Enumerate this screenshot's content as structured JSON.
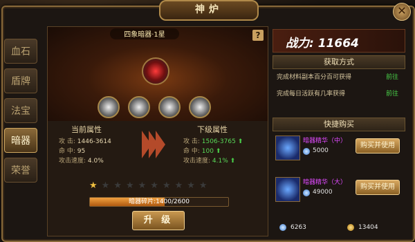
{
  "window": {
    "title": "神炉",
    "close_label": "✕"
  },
  "side_tabs": [
    {
      "label": "血石",
      "active": false
    },
    {
      "label": "盾牌",
      "active": false
    },
    {
      "label": "法宝",
      "active": false
    },
    {
      "label": "暗器",
      "active": true
    },
    {
      "label": "荣誉",
      "active": false
    }
  ],
  "item": {
    "name": "四象暗器·1星",
    "help": "?"
  },
  "current": {
    "heading": "当前属性",
    "attack_key": "攻    击:",
    "attack_val": "1446-3614",
    "hit_key": "命    中:",
    "hit_val": "95",
    "speed_key": "攻击速度:",
    "speed_val": "4.0%"
  },
  "next": {
    "heading": "下级属性",
    "attack_key": "攻    击:",
    "attack_val": "1506-3765",
    "hit_key": "命    中:",
    "hit_val": "100",
    "speed_key": "攻击速度:",
    "speed_val": "4.1%"
  },
  "stars": {
    "filled": 1,
    "total": 10
  },
  "progress": {
    "label": "暗器碎片:1400/2600",
    "current": 1400,
    "max": 2600
  },
  "upgrade_label": "升 级",
  "power": {
    "label": "战力: 11664"
  },
  "sources": {
    "heading": "获取方式",
    "rows": [
      {
        "text": "完成材料副本百分百可获得",
        "link": "前往"
      },
      {
        "text": "完成每日活跃有几率获得",
        "link": "前往"
      }
    ]
  },
  "shop": {
    "heading": "快捷购买",
    "items": [
      {
        "name": "暗器精华（中）",
        "price": "5000",
        "button": "购买并使用"
      },
      {
        "name": "暗器精华（大）",
        "price": "49000",
        "button": "购买并使用"
      }
    ]
  },
  "wallet": {
    "diamonds": "6263",
    "gold": "13404"
  }
}
